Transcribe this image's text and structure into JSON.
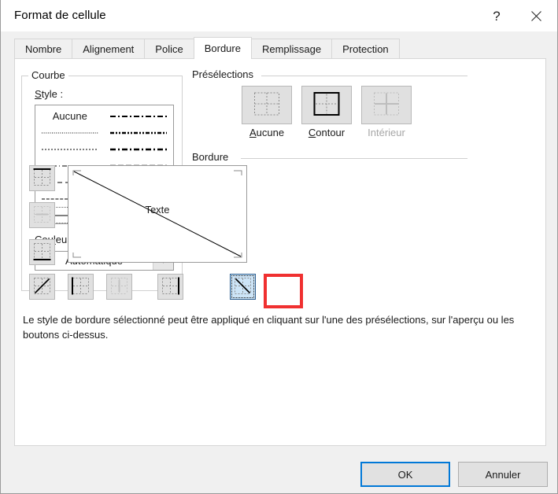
{
  "window": {
    "title": "Format de cellule",
    "help_icon": "?",
    "close_icon": "close-icon"
  },
  "tabs": [
    {
      "label": "Nombre",
      "active": false
    },
    {
      "label": "Alignement",
      "active": false
    },
    {
      "label": "Police",
      "active": false
    },
    {
      "label": "Bordure",
      "active": true
    },
    {
      "label": "Remplissage",
      "active": false
    },
    {
      "label": "Protection",
      "active": false
    }
  ],
  "line_group": {
    "title": "Courbe",
    "style_label": "Style :",
    "styles": {
      "none_label": "Aucune",
      "left_column": [
        "none",
        "dotted-fine",
        "dotted",
        "dash-dot-long",
        "dashed-medium",
        "dashed-fine",
        "thin-solid"
      ],
      "right_column": [
        "dash-dot",
        "dash-dot-dot-bold",
        "dash-dot-bold",
        "dashed-bold",
        "solid-medium",
        "solid-thick",
        "double"
      ],
      "selected": "thin-solid"
    },
    "color_label": "Couleur :",
    "color_value": "Automatique",
    "color_dropdown_icon": "chevron-down-icon"
  },
  "presets": {
    "title": "Présélections",
    "items": [
      {
        "label": "Aucune",
        "icon": "border-none-icon",
        "disabled": false
      },
      {
        "label": "Contour",
        "icon": "border-outline-icon",
        "disabled": false
      },
      {
        "label": "Intérieur",
        "icon": "border-inside-icon",
        "disabled": true
      }
    ]
  },
  "border": {
    "title": "Bordure",
    "left_buttons": [
      {
        "name": "border-top-button",
        "icon": "border-top-icon",
        "disabled": false
      },
      {
        "name": "border-middle-horizontal-button",
        "icon": "border-middle-horizontal-icon",
        "disabled": true
      },
      {
        "name": "border-bottom-button",
        "icon": "border-bottom-icon",
        "disabled": false
      },
      {
        "name": "border-diagonal-up-button",
        "icon": "border-diagonal-up-icon",
        "disabled": false
      }
    ],
    "bottom_buttons": [
      {
        "name": "border-left-button",
        "icon": "border-left-icon",
        "disabled": false
      },
      {
        "name": "border-middle-vertical-button",
        "icon": "border-middle-vertical-icon",
        "disabled": true
      },
      {
        "name": "border-right-button",
        "icon": "border-right-icon",
        "disabled": false
      },
      {
        "name": "border-diagonal-down-button",
        "icon": "border-diagonal-down-icon",
        "disabled": false,
        "selected": true
      }
    ],
    "preview_text": "Texte"
  },
  "description": "Le style de bordure sélectionné peut être appliqué en cliquant sur l'une des présélections, sur l'aperçu ou les boutons ci-dessus.",
  "footer": {
    "ok_label": "OK",
    "cancel_label": "Annuler"
  },
  "colors": {
    "accent": "#0078d7",
    "highlight_red": "#f03030",
    "selected_fill": "#cce4f7",
    "dialog_bg": "#f0f0f0",
    "panel_bg": "#ffffff"
  }
}
